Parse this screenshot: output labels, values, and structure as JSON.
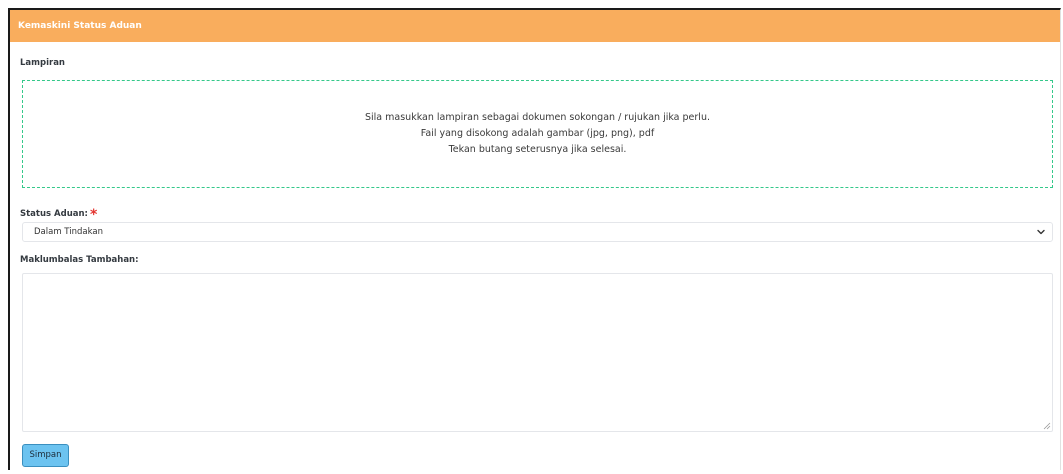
{
  "card": {
    "title": "Kemaskini Status Aduan"
  },
  "attachment": {
    "label": "Lampiran",
    "lines": [
      "Sila masukkan lampiran sebagai dokumen sokongan / rujukan jika perlu.",
      "Fail yang disokong adalah gambar (jpg, png), pdf",
      "Tekan butang seterusnya jika selesai."
    ]
  },
  "status": {
    "label": "Status Aduan:",
    "required_mark": "*",
    "selected": "Dalam Tindakan"
  },
  "feedback": {
    "label": "Maklumbalas Tambahan:",
    "value": ""
  },
  "actions": {
    "save_label": "Simpan"
  },
  "colors": {
    "header_bg": "#f9ad5d",
    "dropzone_border": "#34c88a",
    "required": "#e3342f",
    "button_bg": "#6cc3f0"
  },
  "icons": {
    "select_arrow": "chevron-down-icon",
    "textarea_grip": "resize-grip-icon"
  }
}
